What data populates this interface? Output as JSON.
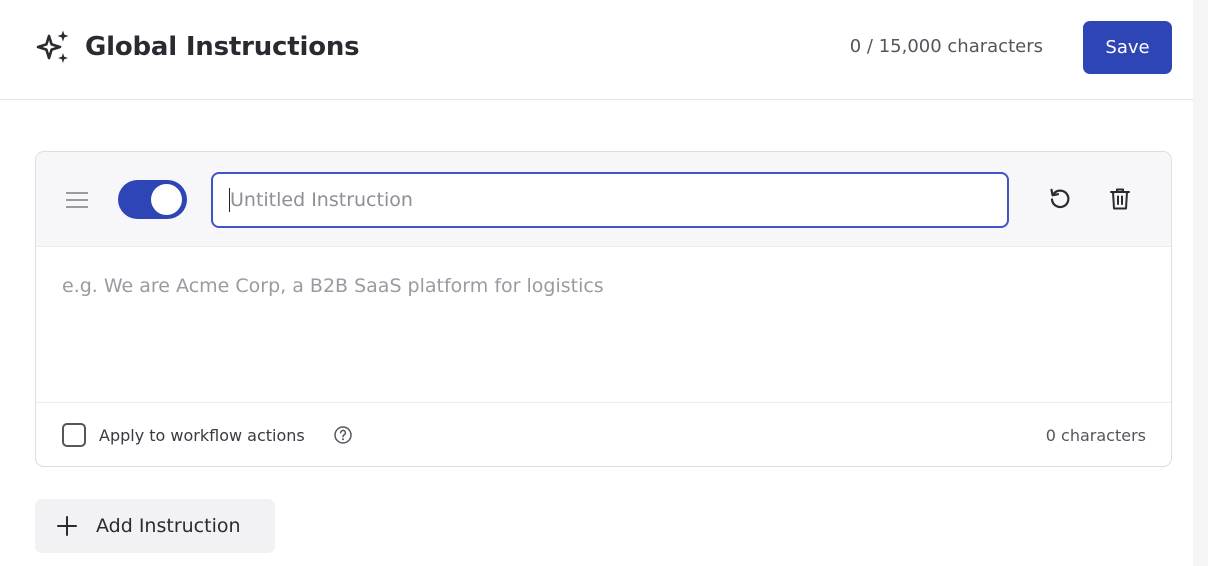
{
  "header": {
    "title": "Global Instructions",
    "char_total": "0 / 15,000 characters",
    "save_label": "Save"
  },
  "instruction": {
    "enabled": true,
    "title_placeholder": "Untitled Instruction",
    "title_value": "",
    "body_placeholder": "e.g. We are Acme Corp, a B2B SaaS platform for logistics",
    "body_value": "",
    "apply_to_workflow_label": "Apply to workflow actions",
    "apply_to_workflow_checked": false,
    "char_count": "0 characters"
  },
  "add_instruction_label": "Add Instruction",
  "colors": {
    "primary": "#2e46b5",
    "border": "#dedee2",
    "muted_text": "#55555d"
  },
  "icons": {
    "title": "sparkles-icon",
    "drag": "drag-handle-icon",
    "reset": "reset-icon",
    "delete": "trash-icon",
    "help": "help-circle-icon",
    "add": "plus-icon"
  }
}
